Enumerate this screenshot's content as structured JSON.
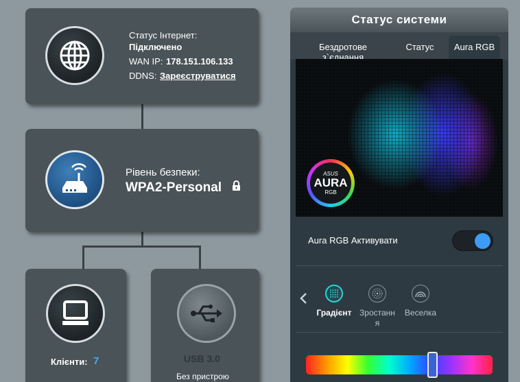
{
  "internet_card": {
    "status_label": "Статус Інтернет:",
    "status_value": "Підключено",
    "wan_label": "WAN IP:",
    "wan_value": "178.151.106.133",
    "ddns_label": "DDNS:",
    "ddns_link": "Зареєструватися",
    "icon": "globe-icon"
  },
  "security_card": {
    "label": "Рівень безпеки:",
    "value": "WPA2-Personal",
    "icon": "router-icon",
    "lock_icon": "lock-icon"
  },
  "clients_card": {
    "label": "Клієнти:",
    "count": "7",
    "icon": "monitor-icon"
  },
  "usb_card": {
    "label": "USB 3.0",
    "status": "Без пристрою",
    "icon": "usb-icon"
  },
  "system_status": {
    "title": "Статус системи",
    "tabs": [
      {
        "label": "Бездротове з`єднання"
      },
      {
        "label": "Статус"
      },
      {
        "label": "Aura RGB",
        "active": true
      }
    ],
    "aura_logo": {
      "brand": "ASUS",
      "name": "AURA",
      "sub": "RGB"
    },
    "activate_label": "Aura RGB Активувати",
    "activate_on": true,
    "effects": [
      {
        "label": "Градієнт",
        "icon": "gradient-effect-icon",
        "selected": true
      },
      {
        "label": "Зростання",
        "icon": "growth-effect-icon"
      },
      {
        "label": "Веселка",
        "icon": "rainbow-effect-icon"
      }
    ],
    "spectrum_position": 0.68
  },
  "colors": {
    "background": "#8e999f",
    "card": "#4a5357",
    "panel": "#2e3a42",
    "accent": "#3c9cf5",
    "clients_count": "#4aa8f0",
    "selected_effect": "#2ad4d4"
  }
}
